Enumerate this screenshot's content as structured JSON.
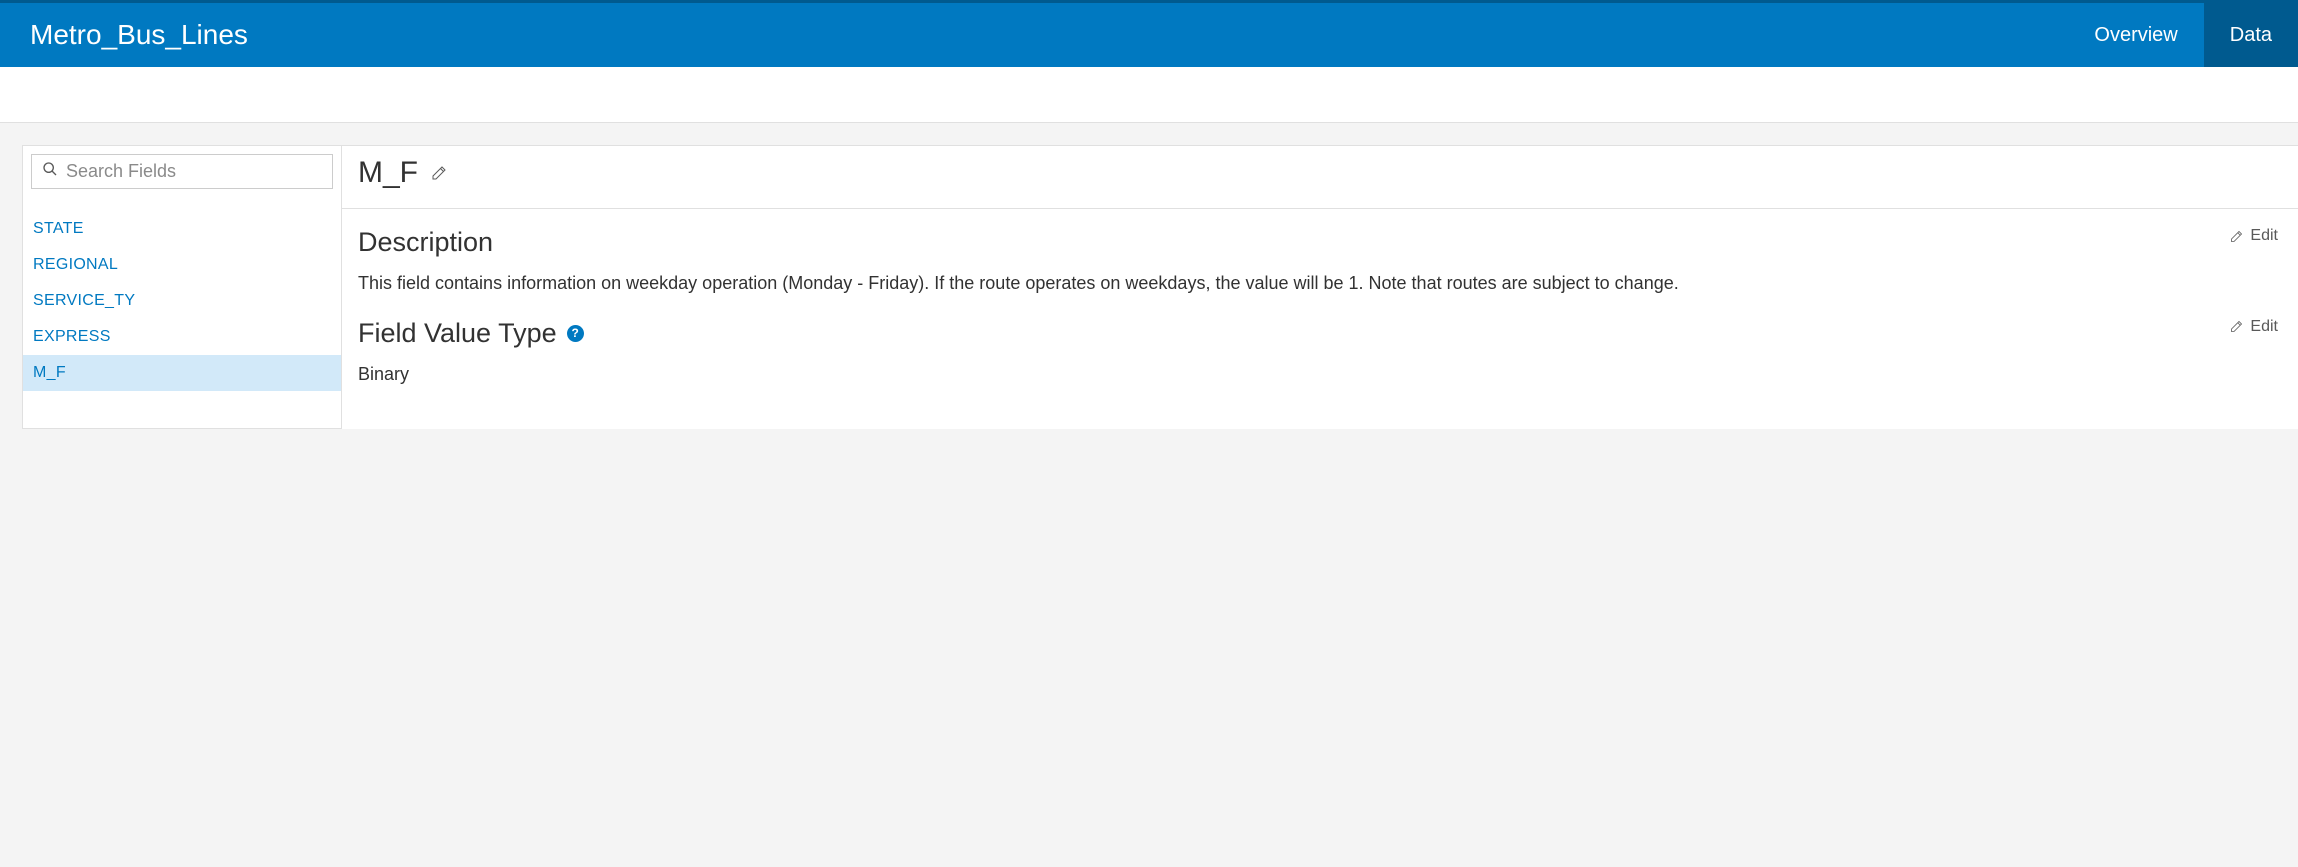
{
  "header": {
    "title": "Metro_Bus_Lines",
    "tabs": {
      "overview": "Overview",
      "data": "Data"
    }
  },
  "sidebar": {
    "search_placeholder": "Search Fields",
    "items": [
      {
        "label": "STATE"
      },
      {
        "label": "REGIONAL"
      },
      {
        "label": "SERVICE_TY"
      },
      {
        "label": "EXPRESS"
      },
      {
        "label": "M_F"
      }
    ]
  },
  "main": {
    "field_name": "M_F",
    "edit_label": "Edit",
    "sections": {
      "description": {
        "title": "Description",
        "body": "This field contains information on weekday operation (Monday - Friday). If the route operates on weekdays, the value will be 1. Note that routes are subject to change."
      },
      "field_value_type": {
        "title": "Field Value Type",
        "body": "Binary"
      }
    }
  }
}
